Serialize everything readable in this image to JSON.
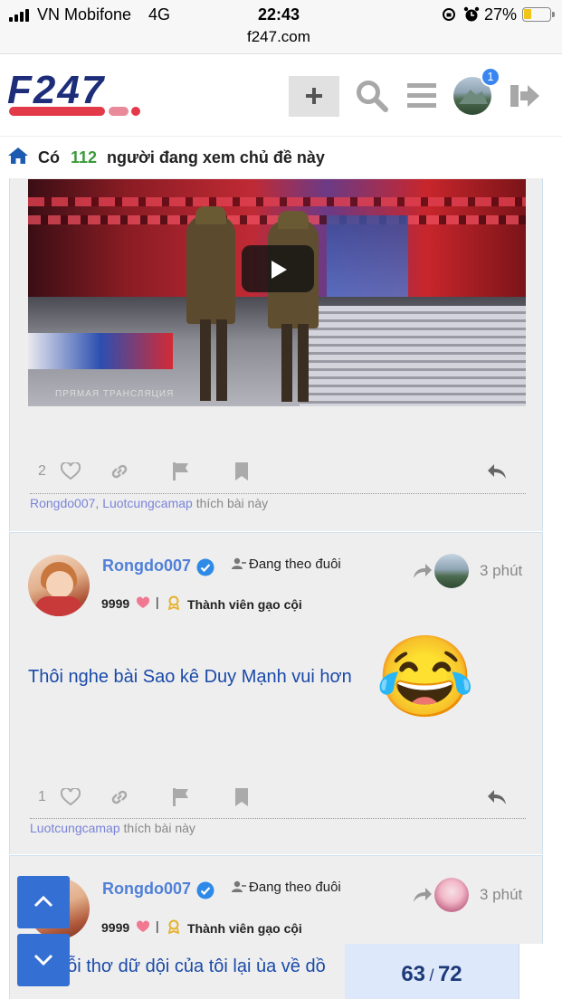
{
  "status_bar": {
    "carrier": "VN Mobifone",
    "network": "4G",
    "time": "22:43",
    "url": "f247.com",
    "battery": "27%"
  },
  "header": {
    "logo_text": "F247",
    "notification_count": "1",
    "accent_color": "#1d2d7a",
    "logo_red": "#e33a4a"
  },
  "viewers": {
    "prefix": "Có",
    "count": "112",
    "suffix": "người đang xem chủ đề này"
  },
  "posts": [
    {
      "like_count": "2",
      "likers": [
        "Rongdo007",
        "Luotcungcamap"
      ],
      "likes_suffix": "thích bài này"
    },
    {
      "username": "Rongdo007",
      "follow_label": "Đang theo đuôi",
      "time": "3 phút",
      "points": "9999",
      "rank": "Thành viên gạo cội",
      "text": "Thôi nghe bài Sao kê Duy Mạnh vui hơn",
      "emoji": "😂",
      "like_count": "1",
      "likers": [
        "Luotcungcamap"
      ],
      "likes_suffix": "thích bài này"
    },
    {
      "username": "Rongdo007",
      "follow_label": "Đang theo đuôi",
      "time": "3 phút",
      "points": "9999",
      "rank": "Thành viên gạo cội",
      "text": "nỗi thơ dữ dội của tôi lại ùa về dồ"
    }
  ],
  "pager": {
    "current": "63",
    "sep": "/",
    "total": "72"
  },
  "icons": {
    "scroll_up": "chevron-up-icon",
    "scroll_down": "chevron-down-icon"
  }
}
